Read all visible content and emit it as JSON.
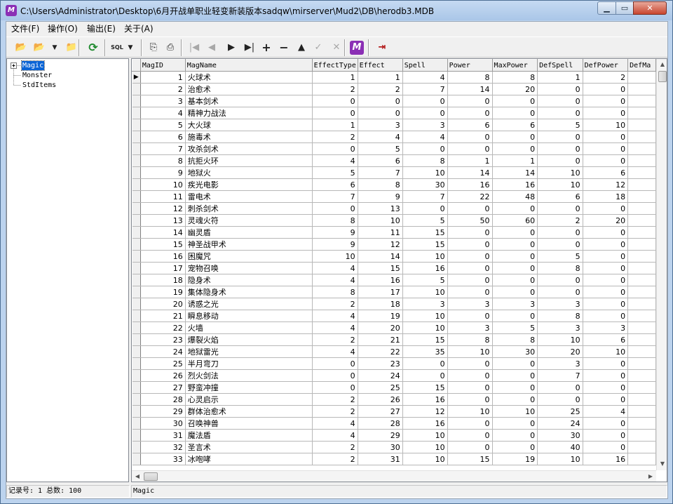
{
  "window": {
    "title": "C:\\Users\\Administrator\\Desktop\\6月开战单职业轻变新装版本sadqw\\mirserver\\Mud2\\DB\\herodb3.MDB",
    "app_icon": "m-logo-icon",
    "minimize_label": "▁",
    "maximize_label": "▭",
    "close_label": "✕"
  },
  "menu": [
    {
      "label": "文件(F)"
    },
    {
      "label": "操作(O)"
    },
    {
      "label": "输出(E)"
    },
    {
      "label": "关于(A)"
    }
  ],
  "toolbar": {
    "buttons": [
      {
        "icon": "open-folder-icon",
        "glyph": "📂"
      },
      {
        "icon": "open-folder-alt-icon",
        "glyph": "📂"
      },
      {
        "icon": "dropdown-arrow-icon",
        "glyph": "▼"
      },
      {
        "icon": "folder-icon",
        "glyph": "📁"
      },
      {
        "icon": "refresh-icon",
        "glyph": "⟳"
      },
      {
        "icon": "sql-icon",
        "glyph": "SQL"
      },
      {
        "icon": "dropdown-arrow-icon",
        "glyph": "▼"
      },
      {
        "icon": "copy-icon",
        "glyph": "⎘"
      },
      {
        "icon": "print-icon",
        "glyph": "⎙"
      },
      {
        "icon": "first-record-icon",
        "glyph": "|◀"
      },
      {
        "icon": "prior-record-icon",
        "glyph": "◀"
      },
      {
        "icon": "next-record-icon",
        "glyph": "▶"
      },
      {
        "icon": "last-record-icon",
        "glyph": "▶|"
      },
      {
        "icon": "insert-record-icon",
        "glyph": "+"
      },
      {
        "icon": "delete-record-icon",
        "glyph": "−"
      },
      {
        "icon": "edit-record-icon",
        "glyph": "▲"
      },
      {
        "icon": "post-record-icon",
        "glyph": "✓"
      },
      {
        "icon": "cancel-record-icon",
        "glyph": "✕"
      },
      {
        "icon": "app-logo-icon",
        "glyph": "M"
      },
      {
        "icon": "exit-icon",
        "glyph": "⇥"
      }
    ]
  },
  "tree": {
    "nodes": [
      {
        "label": "Magic",
        "selected": true
      },
      {
        "label": "Monster",
        "selected": false
      },
      {
        "label": "StdItems",
        "selected": false
      }
    ]
  },
  "grid": {
    "columns": [
      "MagID",
      "MagName",
      "EffectType",
      "Effect",
      "Spell",
      "Power",
      "MaxPower",
      "DefSpell",
      "DefPower",
      "DefMa"
    ],
    "rows": [
      [
        "1",
        "火球术",
        "1",
        "1",
        "4",
        "8",
        "8",
        "1",
        "2"
      ],
      [
        "2",
        "治愈术",
        "2",
        "2",
        "7",
        "14",
        "20",
        "0",
        "0"
      ],
      [
        "3",
        "基本剑术",
        "0",
        "0",
        "0",
        "0",
        "0",
        "0",
        "0"
      ],
      [
        "4",
        "精神力战法",
        "0",
        "0",
        "0",
        "0",
        "0",
        "0",
        "0"
      ],
      [
        "5",
        "大火球",
        "1",
        "3",
        "3",
        "6",
        "6",
        "5",
        "10"
      ],
      [
        "6",
        "施毒术",
        "2",
        "4",
        "4",
        "0",
        "0",
        "0",
        "0"
      ],
      [
        "7",
        "攻杀剑术",
        "0",
        "5",
        "0",
        "0",
        "0",
        "0",
        "0"
      ],
      [
        "8",
        "抗拒火环",
        "4",
        "6",
        "8",
        "1",
        "1",
        "0",
        "0"
      ],
      [
        "9",
        "地狱火",
        "5",
        "7",
        "10",
        "14",
        "14",
        "10",
        "6"
      ],
      [
        "10",
        "疾光电影",
        "6",
        "8",
        "30",
        "16",
        "16",
        "10",
        "12"
      ],
      [
        "11",
        "雷电术",
        "7",
        "9",
        "7",
        "22",
        "48",
        "6",
        "18"
      ],
      [
        "12",
        "刺杀剑术",
        "0",
        "13",
        "0",
        "0",
        "0",
        "0",
        "0"
      ],
      [
        "13",
        "灵魂火符",
        "8",
        "10",
        "5",
        "50",
        "60",
        "2",
        "20"
      ],
      [
        "14",
        "幽灵盾",
        "9",
        "11",
        "15",
        "0",
        "0",
        "0",
        "0"
      ],
      [
        "15",
        "神圣战甲术",
        "9",
        "12",
        "15",
        "0",
        "0",
        "0",
        "0"
      ],
      [
        "16",
        "困魔咒",
        "10",
        "14",
        "10",
        "0",
        "0",
        "5",
        "0"
      ],
      [
        "17",
        "宠物召唤",
        "4",
        "15",
        "16",
        "0",
        "0",
        "8",
        "0"
      ],
      [
        "18",
        "隐身术",
        "4",
        "16",
        "5",
        "0",
        "0",
        "0",
        "0"
      ],
      [
        "19",
        "集体隐身术",
        "8",
        "17",
        "10",
        "0",
        "0",
        "0",
        "0"
      ],
      [
        "20",
        "诱惑之光",
        "2",
        "18",
        "3",
        "3",
        "3",
        "3",
        "0"
      ],
      [
        "21",
        "瞬息移动",
        "4",
        "19",
        "10",
        "0",
        "0",
        "8",
        "0"
      ],
      [
        "22",
        "火墙",
        "4",
        "20",
        "10",
        "3",
        "5",
        "3",
        "3"
      ],
      [
        "23",
        "爆裂火焰",
        "2",
        "21",
        "15",
        "8",
        "8",
        "10",
        "6"
      ],
      [
        "24",
        "地狱雷光",
        "4",
        "22",
        "35",
        "10",
        "30",
        "20",
        "10"
      ],
      [
        "25",
        "半月弯刀",
        "0",
        "23",
        "0",
        "0",
        "0",
        "3",
        "0"
      ],
      [
        "26",
        "烈火剑法",
        "0",
        "24",
        "0",
        "0",
        "0",
        "7",
        "0"
      ],
      [
        "27",
        "野蛮冲撞",
        "0",
        "25",
        "15",
        "0",
        "0",
        "0",
        "0"
      ],
      [
        "28",
        "心灵启示",
        "2",
        "26",
        "16",
        "0",
        "0",
        "0",
        "0"
      ],
      [
        "29",
        "群体治愈术",
        "2",
        "27",
        "12",
        "10",
        "10",
        "25",
        "4"
      ],
      [
        "30",
        "召唤神兽",
        "4",
        "28",
        "16",
        "0",
        "0",
        "24",
        "0"
      ],
      [
        "31",
        "魔法盾",
        "4",
        "29",
        "10",
        "0",
        "0",
        "30",
        "0"
      ],
      [
        "32",
        "圣言术",
        "2",
        "30",
        "10",
        "0",
        "0",
        "40",
        "0"
      ],
      [
        "33",
        "冰咆哮",
        "2",
        "31",
        "10",
        "15",
        "19",
        "10",
        "16"
      ]
    ],
    "current_row_indicator": "▶"
  },
  "statusbar": {
    "record_info": "记录号: 1 总数: 100",
    "table_name": "Magic"
  }
}
